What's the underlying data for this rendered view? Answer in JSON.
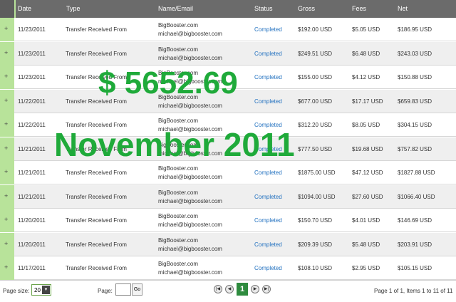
{
  "columns": {
    "date": "Date",
    "type": "Type",
    "name_email": "Name/Email",
    "status": "Status",
    "gross": "Gross",
    "fees": "Fees",
    "net": "Net"
  },
  "rows": [
    {
      "expand": "+",
      "date": "11/23/2011",
      "type": "Transfer Received From",
      "name": "BigBooster.com",
      "email": "michael@bigbooster.com",
      "status": "Completed",
      "gross": "$192.00 USD",
      "fees": "$5.05 USD",
      "net": "$186.95 USD"
    },
    {
      "expand": "+",
      "date": "11/23/2011",
      "type": "Transfer Received From",
      "name": "BigBooster.com",
      "email": "michael@bigbooster.com",
      "status": "Completed",
      "gross": "$249.51 USD",
      "fees": "$6.48 USD",
      "net": "$243.03 USD"
    },
    {
      "expand": "+",
      "date": "11/23/2011",
      "type": "Transfer Received From",
      "name": "BigBooster.com",
      "email": "michael@bigbooster.com",
      "status": "Completed",
      "gross": "$155.00 USD",
      "fees": "$4.12 USD",
      "net": "$150.88 USD"
    },
    {
      "expand": "+",
      "date": "11/22/2011",
      "type": "Transfer Received From",
      "name": "BigBooster.com",
      "email": "michael@bigbooster.com",
      "status": "Completed",
      "gross": "$677.00 USD",
      "fees": "$17.17 USD",
      "net": "$659.83 USD"
    },
    {
      "expand": "+",
      "date": "11/22/2011",
      "type": "Transfer Received From",
      "name": "BigBooster.com",
      "email": "michael@bigbooster.com",
      "status": "Completed",
      "gross": "$312.20 USD",
      "fees": "$8.05 USD",
      "net": "$304.15 USD"
    },
    {
      "expand": "+",
      "date": "11/21/2011",
      "type": "Transfer Received From",
      "name": "BigBooster.com",
      "email": "michael@bigbooster.com",
      "status": "Completed",
      "gross": "$777.50 USD",
      "fees": "$19.68 USD",
      "net": "$757.82 USD"
    },
    {
      "expand": "+",
      "date": "11/21/2011",
      "type": "Transfer Received From",
      "name": "BigBooster.com",
      "email": "michael@bigbooster.com",
      "status": "Completed",
      "gross": "$1875.00 USD",
      "fees": "$47.12 USD",
      "net": "$1827.88 USD"
    },
    {
      "expand": "+",
      "date": "11/21/2011",
      "type": "Transfer Received From",
      "name": "BigBooster.com",
      "email": "michael@bigbooster.com",
      "status": "Completed",
      "gross": "$1094.00 USD",
      "fees": "$27.60 USD",
      "net": "$1066.40 USD"
    },
    {
      "expand": "+",
      "date": "11/20/2011",
      "type": "Transfer Received From",
      "name": "BigBooster.com",
      "email": "michael@bigbooster.com",
      "status": "Completed",
      "gross": "$150.70 USD",
      "fees": "$4.01 USD",
      "net": "$146.69 USD"
    },
    {
      "expand": "+",
      "date": "11/20/2011",
      "type": "Transfer Received From",
      "name": "BigBooster.com",
      "email": "michael@bigbooster.com",
      "status": "Completed",
      "gross": "$209.39 USD",
      "fees": "$5.48 USD",
      "net": "$203.91 USD"
    },
    {
      "expand": "+",
      "date": "11/17/2011",
      "type": "Transfer Received From",
      "name": "BigBooster.com",
      "email": "michael@bigbooster.com",
      "status": "Completed",
      "gross": "$108.10 USD",
      "fees": "$2.95 USD",
      "net": "$105.15 USD"
    }
  ],
  "pager": {
    "page_size_label": "Page size:",
    "page_size_value": "20",
    "page_label": "Page:",
    "go_label": "Go",
    "current_page": "1",
    "first_icon": "first-page-icon",
    "prev_icon": "prev-page-icon",
    "next_icon": "next-page-icon",
    "last_icon": "last-page-icon",
    "summary": "Page 1 of 1, Items 1 to 11 of 11"
  },
  "overlay": {
    "amount": "$ 5652.69",
    "period": "November 2011"
  },
  "colors": {
    "header_bg": "#6b6b6b",
    "expand_col": "#b8e39a",
    "status_link": "#1f6fbf",
    "overlay_green": "#1faa3a",
    "current_page_bg": "#2e8b3e"
  }
}
